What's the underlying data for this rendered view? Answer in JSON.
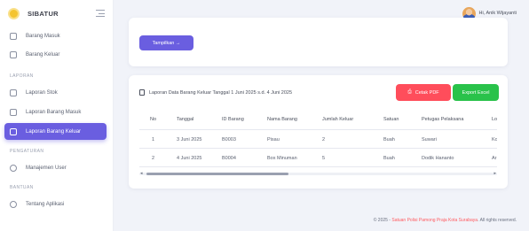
{
  "brand": {
    "name": "SIBATUR"
  },
  "header": {
    "greeting": "Hi, Anik Wijayanti"
  },
  "sidebar": {
    "items_top": [
      {
        "label": "Barang Masuk",
        "icon": "inbox-icon"
      },
      {
        "label": "Barang Keluar",
        "icon": "outbox-icon"
      }
    ],
    "section_laporan": "LAPORAN",
    "items_laporan": [
      {
        "label": "Laporan Stok",
        "icon": "file-icon"
      },
      {
        "label": "Laporan Barang Masuk",
        "icon": "file-icon"
      },
      {
        "label": "Laporan Barang Keluar",
        "icon": "file-icon"
      }
    ],
    "section_pengaturan": "PENGATURAN",
    "item_user": {
      "label": "Manajemen User",
      "icon": "user-icon"
    },
    "section_bantuan": "BANTUAN",
    "item_help": {
      "label": "Tentang Aplikasi",
      "icon": "info-icon"
    }
  },
  "filter": {
    "show_label": "Tampilkan →"
  },
  "report": {
    "title": "Laporan Data Barang Keluar Tanggal 1 Juni 2025 s.d. 4 Juni 2025",
    "pdf_label": "Cetak PDF",
    "excel_label": "Export Excel"
  },
  "table": {
    "columns": [
      "No",
      "Tanggal",
      "ID Barang",
      "Nama Barang",
      "Jumlah Keluar",
      "Satuan",
      "Petugas Pelaksana",
      "Lo"
    ],
    "rows": [
      [
        "1",
        "3 Juni 2025",
        "B0003",
        "Pisau",
        "2",
        "Buah",
        "Suwari",
        "Ko"
      ],
      [
        "2",
        "4 Juni 2025",
        "B0004",
        "Box Minuman",
        "5",
        "Buah",
        "Dodik Hananto",
        "Ar"
      ]
    ]
  },
  "footer": {
    "prefix": "© 2025 - ",
    "org": "Satuan Polisi Pamong Praja Kota Surabaya",
    "suffix": ". All rights reserved."
  },
  "colors": {
    "accent": "#6a5ee0",
    "danger": "#ff4d5b",
    "success": "#29c24a"
  }
}
